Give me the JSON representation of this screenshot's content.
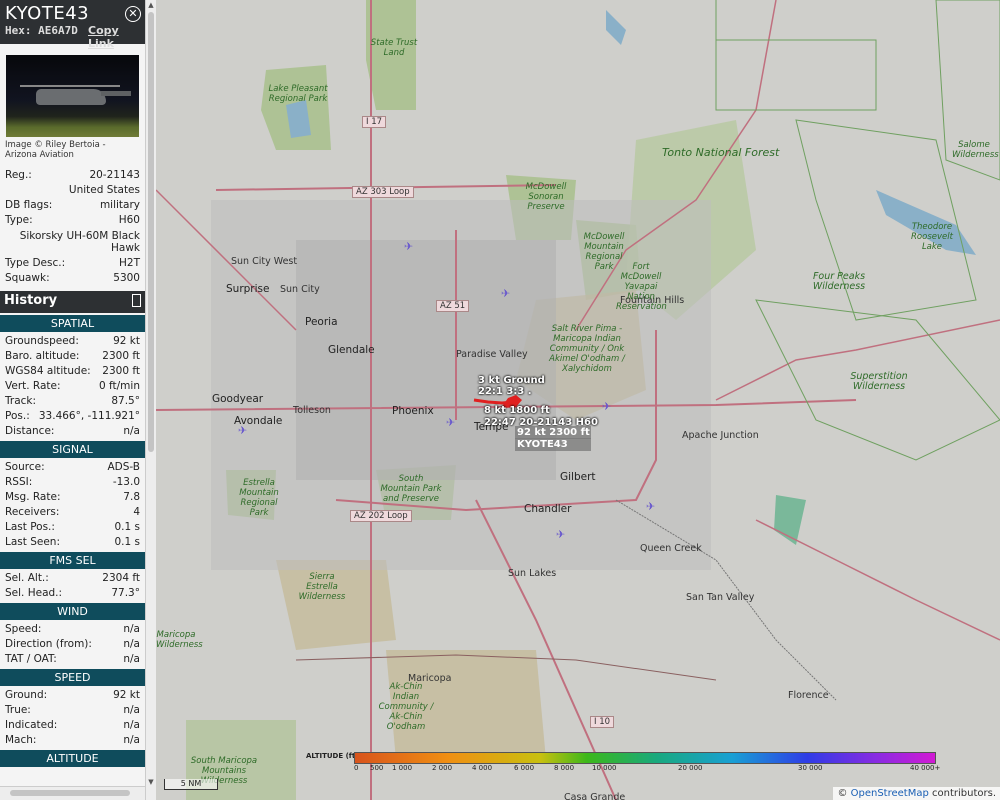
{
  "aircraft": {
    "callsign": "KYOTE43",
    "hex_label": "Hex:",
    "hex": "AE6A7D",
    "copy_link": "Copy Link",
    "close_icon": "close-icon",
    "photo_credit": "Image © Riley Bertoia - Arizona Aviation"
  },
  "info": {
    "reg_label": "Reg.:",
    "reg": "20-21143",
    "country": "United States",
    "dbflags_label": "DB flags:",
    "dbflags": "military",
    "type_label": "Type:",
    "type": "H60",
    "type_full": "Sikorsky UH-60M Black Hawk",
    "typedesc_label": "Type Desc.:",
    "typedesc": "H2T",
    "squawk_label": "Squawk:",
    "squawk": "5300"
  },
  "history_label": "History",
  "spatial": {
    "title": "SPATIAL",
    "rows": [
      {
        "k": "Groundspeed:",
        "v": "92 kt"
      },
      {
        "k": "Baro. altitude:",
        "v": "2300 ft"
      },
      {
        "k": "WGS84 altitude:",
        "v": "2300 ft"
      },
      {
        "k": "Vert. Rate:",
        "v": "0 ft/min"
      },
      {
        "k": "Track:",
        "v": "87.5°"
      },
      {
        "k": "Pos.:",
        "v": "33.466°, -111.921°"
      },
      {
        "k": "Distance:",
        "v": "n/a"
      }
    ]
  },
  "signal": {
    "title": "SIGNAL",
    "rows": [
      {
        "k": "Source:",
        "v": "ADS-B"
      },
      {
        "k": "RSSI:",
        "v": "-13.0"
      },
      {
        "k": "Msg. Rate:",
        "v": "7.8"
      },
      {
        "k": "Receivers:",
        "v": "4"
      },
      {
        "k": "Last Pos.:",
        "v": "0.1 s"
      },
      {
        "k": "Last Seen:",
        "v": "0.1 s"
      }
    ]
  },
  "fms": {
    "title": "FMS SEL",
    "rows": [
      {
        "k": "Sel. Alt.:",
        "v": "2304 ft"
      },
      {
        "k": "Sel. Head.:",
        "v": "77.3°"
      }
    ]
  },
  "wind": {
    "title": "WIND",
    "rows": [
      {
        "k": "Speed:",
        "v": "n/a"
      },
      {
        "k": "Direction (from):",
        "v": "n/a"
      },
      {
        "k": "TAT / OAT:",
        "v": "n/a"
      }
    ]
  },
  "speed": {
    "title": "SPEED",
    "rows": [
      {
        "k": "Ground:",
        "v": "92 kt"
      },
      {
        "k": "True:",
        "v": "n/a"
      },
      {
        "k": "Indicated:",
        "v": "n/a"
      },
      {
        "k": "Mach:",
        "v": "n/a"
      }
    ]
  },
  "altitude_title": "ALTITUDE",
  "map": {
    "places": {
      "phoenix": "Phoenix",
      "glendale": "Glendale",
      "peoria": "Peoria",
      "surprise": "Surprise",
      "suncitywest": "Sun City West",
      "suncity": "Sun City",
      "goodyear": "Goodyear",
      "avondale": "Avondale",
      "tolleson": "Tolleson",
      "tempe": "Tempe",
      "gilbert": "Gilbert",
      "chandler": "Chandler",
      "paradise": "Paradise Valley",
      "fountain": "Fountain Hills",
      "apache": "Apache Junction",
      "queen": "Queen Creek",
      "suntan": "San Tan Valley",
      "sunlakes": "Sun Lakes",
      "maricopa": "Maricopa",
      "florence": "Florence",
      "casa": "Casa Grande"
    },
    "parks": {
      "statetrust": "State Trust Land",
      "lakepleasant": "Lake Pleasant Regional Park",
      "mcdsonoran": "McDowell Sonoran Preserve",
      "mcdmountain": "McDowell Mountain Regional Park",
      "ftmcdowell": "Fort McDowell Yavapai Nation Reservation",
      "srp": "Salt River Pima - Maricopa Indian Community / Onk Akimel O'odham / Xalychidom",
      "estrella": "Estrella Mountain Regional Park",
      "southmtn": "South Mountain Park and Preserve",
      "sierra": "Sierra Estrella Wilderness",
      "akchin": "Ak-Chin Indian Community / Ak-Chin O'odham",
      "southmaricopa": "South Maricopa Mountains Wilderness",
      "maricopaw": "Maricopa Wilderness",
      "salome": "Salome Wilderness",
      "roosevelt": "Theodore Roosevelt Lake",
      "fourpeaks": "Four Peaks Wilderness",
      "superstition": "Superstition Wilderness"
    },
    "tonto": "Tonto National Forest",
    "roads": {
      "i17": "I 17",
      "az303": "AZ 303 Loop",
      "az51": "AZ 51",
      "az202": "AZ 202 Loop",
      "i10": "I 10"
    },
    "aircraft_labels": {
      "a1": "3 kt  Ground",
      "a2": "22:1 3:3 .",
      "a3": "8  kt  1800 ft",
      "a4": "22:47 20-21143 H60",
      "a5": "92 kt  2300 ft",
      "a6": "KYOTE43"
    },
    "legend": {
      "title": "ALTITUDE (ft)",
      "ticks": [
        "0",
        "500",
        "1 000",
        "2 000",
        "4 000",
        "6 000",
        "8 000",
        "10 000",
        "20 000",
        "30 000",
        "40 000+"
      ]
    },
    "scale": "5 NM",
    "attribution_prefix": "© ",
    "attribution_link": "OpenStreetMap",
    "attribution_suffix": " contributors."
  },
  "colors": {
    "section": "#0f4c5c",
    "header": "#2d3033",
    "track": "#e02020"
  }
}
